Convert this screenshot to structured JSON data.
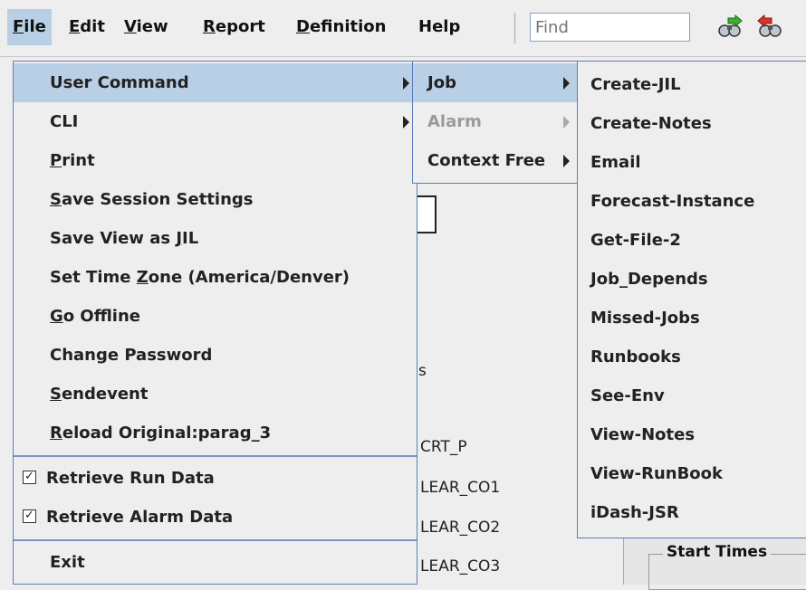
{
  "menubar": {
    "items": [
      {
        "label": "File",
        "mnemonic": "F",
        "rest": "ile"
      },
      {
        "label": "Edit",
        "mnemonic": "E",
        "rest": "dit"
      },
      {
        "label": "View",
        "mnemonic": "V",
        "rest": "iew"
      },
      {
        "label": "Report",
        "mnemonic": "R",
        "rest": "eport"
      },
      {
        "label": "Definition",
        "mnemonic": "D",
        "rest": "efinition"
      },
      {
        "label": "Help",
        "mnemonic": "",
        "rest": "Help"
      }
    ],
    "find_placeholder": "Find",
    "icons": [
      "find-next-icon",
      "find-previous-icon"
    ]
  },
  "file_menu": {
    "items": [
      {
        "pre": "",
        "u": "",
        "post": "User Command",
        "submenu": true
      },
      {
        "pre": "",
        "u": "",
        "post": "CLI",
        "submenu": true
      },
      {
        "pre": "",
        "u": "P",
        "post": "rint"
      },
      {
        "pre": "",
        "u": "S",
        "post": "ave Session Settings"
      },
      {
        "pre": "Save View as ",
        "u": "J",
        "post": "IL"
      },
      {
        "pre": "Set Time ",
        "u": "Z",
        "post": "one (America/Denver)"
      },
      {
        "pre": "",
        "u": "G",
        "post": "o Offline"
      },
      {
        "pre": "",
        "u": "",
        "post": "Change Password"
      },
      {
        "pre": "",
        "u": "S",
        "post": "endevent"
      },
      {
        "pre": "",
        "u": "R",
        "post": "eload Original:parag_3"
      },
      {
        "pre": "",
        "u": "",
        "post": "Retrieve Run Data",
        "checked": true
      },
      {
        "pre": "",
        "u": "",
        "post": "Retrieve Alarm Data",
        "checked": true
      },
      {
        "pre": "",
        "u": "",
        "post": "Exit"
      }
    ]
  },
  "user_command_menu": {
    "items": [
      {
        "label": "Job",
        "submenu": true
      },
      {
        "label": "Alarm",
        "submenu": true,
        "disabled": true
      },
      {
        "label": "Context Free",
        "submenu": true
      }
    ]
  },
  "job_menu": {
    "items": [
      "Create-JIL",
      "Create-Notes",
      "Email",
      "Forecast-Instance",
      "Get-File-2",
      "Job_Depends",
      "Missed-Jobs",
      "Runbooks",
      "See-Env",
      "View-Notes",
      "View-RunBook",
      "iDash-JSR"
    ]
  },
  "background": {
    "partial_s": "s",
    "rows": [
      "CRT_P",
      "LEAR_CO1",
      "LEAR_CO2",
      "LEAR_CO3"
    ],
    "group_label": "Start Times"
  },
  "colors": {
    "highlight": "#b8cfe5",
    "menu_border": "#5c7cbc",
    "menu_bg": "#eeeeee"
  }
}
